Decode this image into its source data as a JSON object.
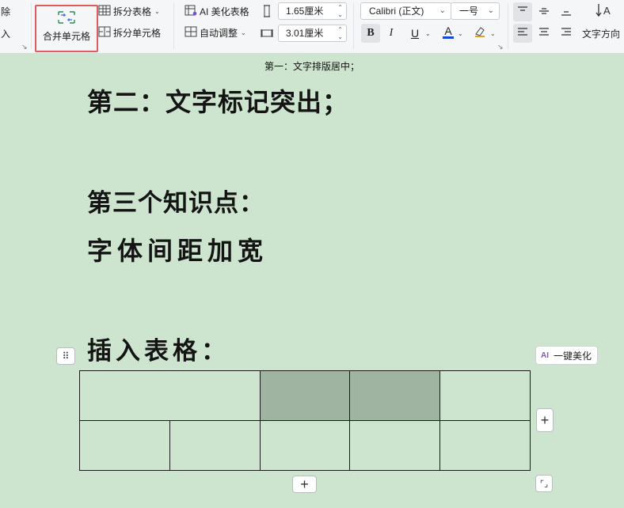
{
  "ribbon": {
    "left_cut": {
      "top": "除",
      "bottom": "入"
    },
    "merge_cells": "合并单元格",
    "split_table": "拆分表格",
    "split_cells": "拆分单元格",
    "ai_beautify_table": "AI 美化表格",
    "auto_adjust": "自动调整",
    "row_height": "1.65厘米",
    "col_width": "3.01厘米",
    "font_name": "Calibri (正文)",
    "font_size": "一号",
    "bold": "B",
    "italic": "I",
    "underline": "U",
    "font_color": "A",
    "text_direction": "文字方向"
  },
  "document": {
    "header_line": "第一：文字排版居中；",
    "heading_1": "第二：文字标记突出；",
    "heading_2": "第三个知识点：",
    "heading_3": "字体间距加宽",
    "heading_4": "插入表格：",
    "ai_beautify_button": "一键美化",
    "ai_badge": "AI"
  },
  "colors": {
    "page_background": "#cde5cf",
    "shaded_cell": "#9fb5a1",
    "highlight_border": "#e05b5b",
    "font_color_underline": "#1646d8"
  },
  "icons": [
    "merge-cells-icon",
    "split-table-icon",
    "split-cells-icon",
    "ai-table-icon",
    "auto-adjust-icon",
    "row-height-icon",
    "col-width-icon",
    "align-top-icon",
    "align-middle-icon",
    "align-bottom-icon",
    "align-left-icon",
    "align-center-icon",
    "align-right-icon",
    "text-direction-icon",
    "table-move-handle-icon",
    "add-column-icon",
    "add-row-icon",
    "resize-table-icon"
  ]
}
